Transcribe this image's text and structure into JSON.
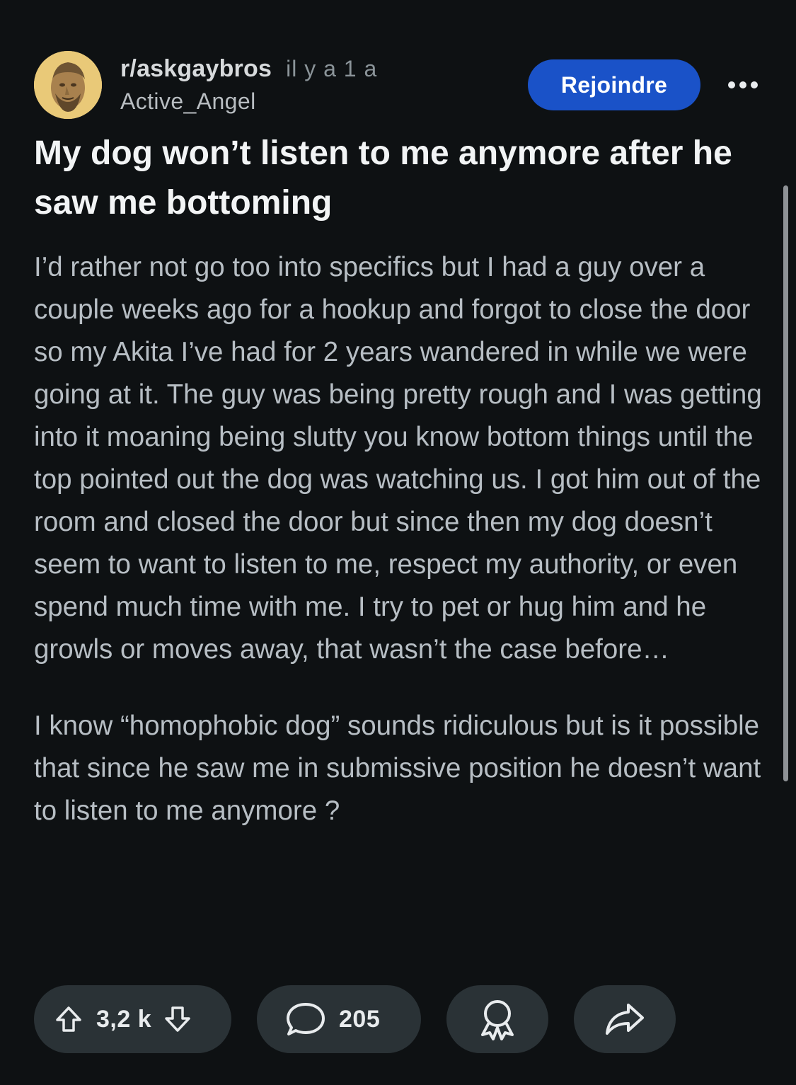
{
  "post": {
    "subreddit": "r/askgaybros",
    "time_ago": "il y a 1 a",
    "author": "Active_Angel",
    "join_label": "Rejoindre",
    "title": "My dog won’t listen to me anymore after he saw me bottoming",
    "body": [
      "I’d rather not go too into specifics but I had a guy over a couple weeks ago for a hookup and forgot to close the door so my Akita I’ve had for 2 years wandered in while we were going at it. The guy was being pretty rough and I was getting into it moaning being slutty you know bottom things until the top pointed out the dog was watching us. I got him out of the room and closed the door but since then my dog doesn’t seem to want to listen to me, respect my authority, or even spend much time with me. I try to pet or hug him and he growls or moves away, that wasn’t the case before…",
      "I know “homophobic dog” sounds ridiculous but is it possible that since he saw me in submissive position he doesn’t want to listen to me anymore ?"
    ]
  },
  "actions": {
    "vote_count": "3,2 k",
    "comment_count": "205"
  },
  "icons": {
    "avatar": "bust-statue-avatar",
    "more": "more-horizontal-icon",
    "upvote": "upvote-arrow-icon",
    "downvote": "downvote-arrow-icon",
    "comment": "speech-bubble-icon",
    "award": "award-ribbon-icon",
    "share": "share-arrow-icon"
  },
  "colors": {
    "background": "#0e1113",
    "join_button": "#1a52c8",
    "pill": "#2a3236",
    "body_text": "#b7bec4",
    "title_text": "#f2f4f5"
  }
}
